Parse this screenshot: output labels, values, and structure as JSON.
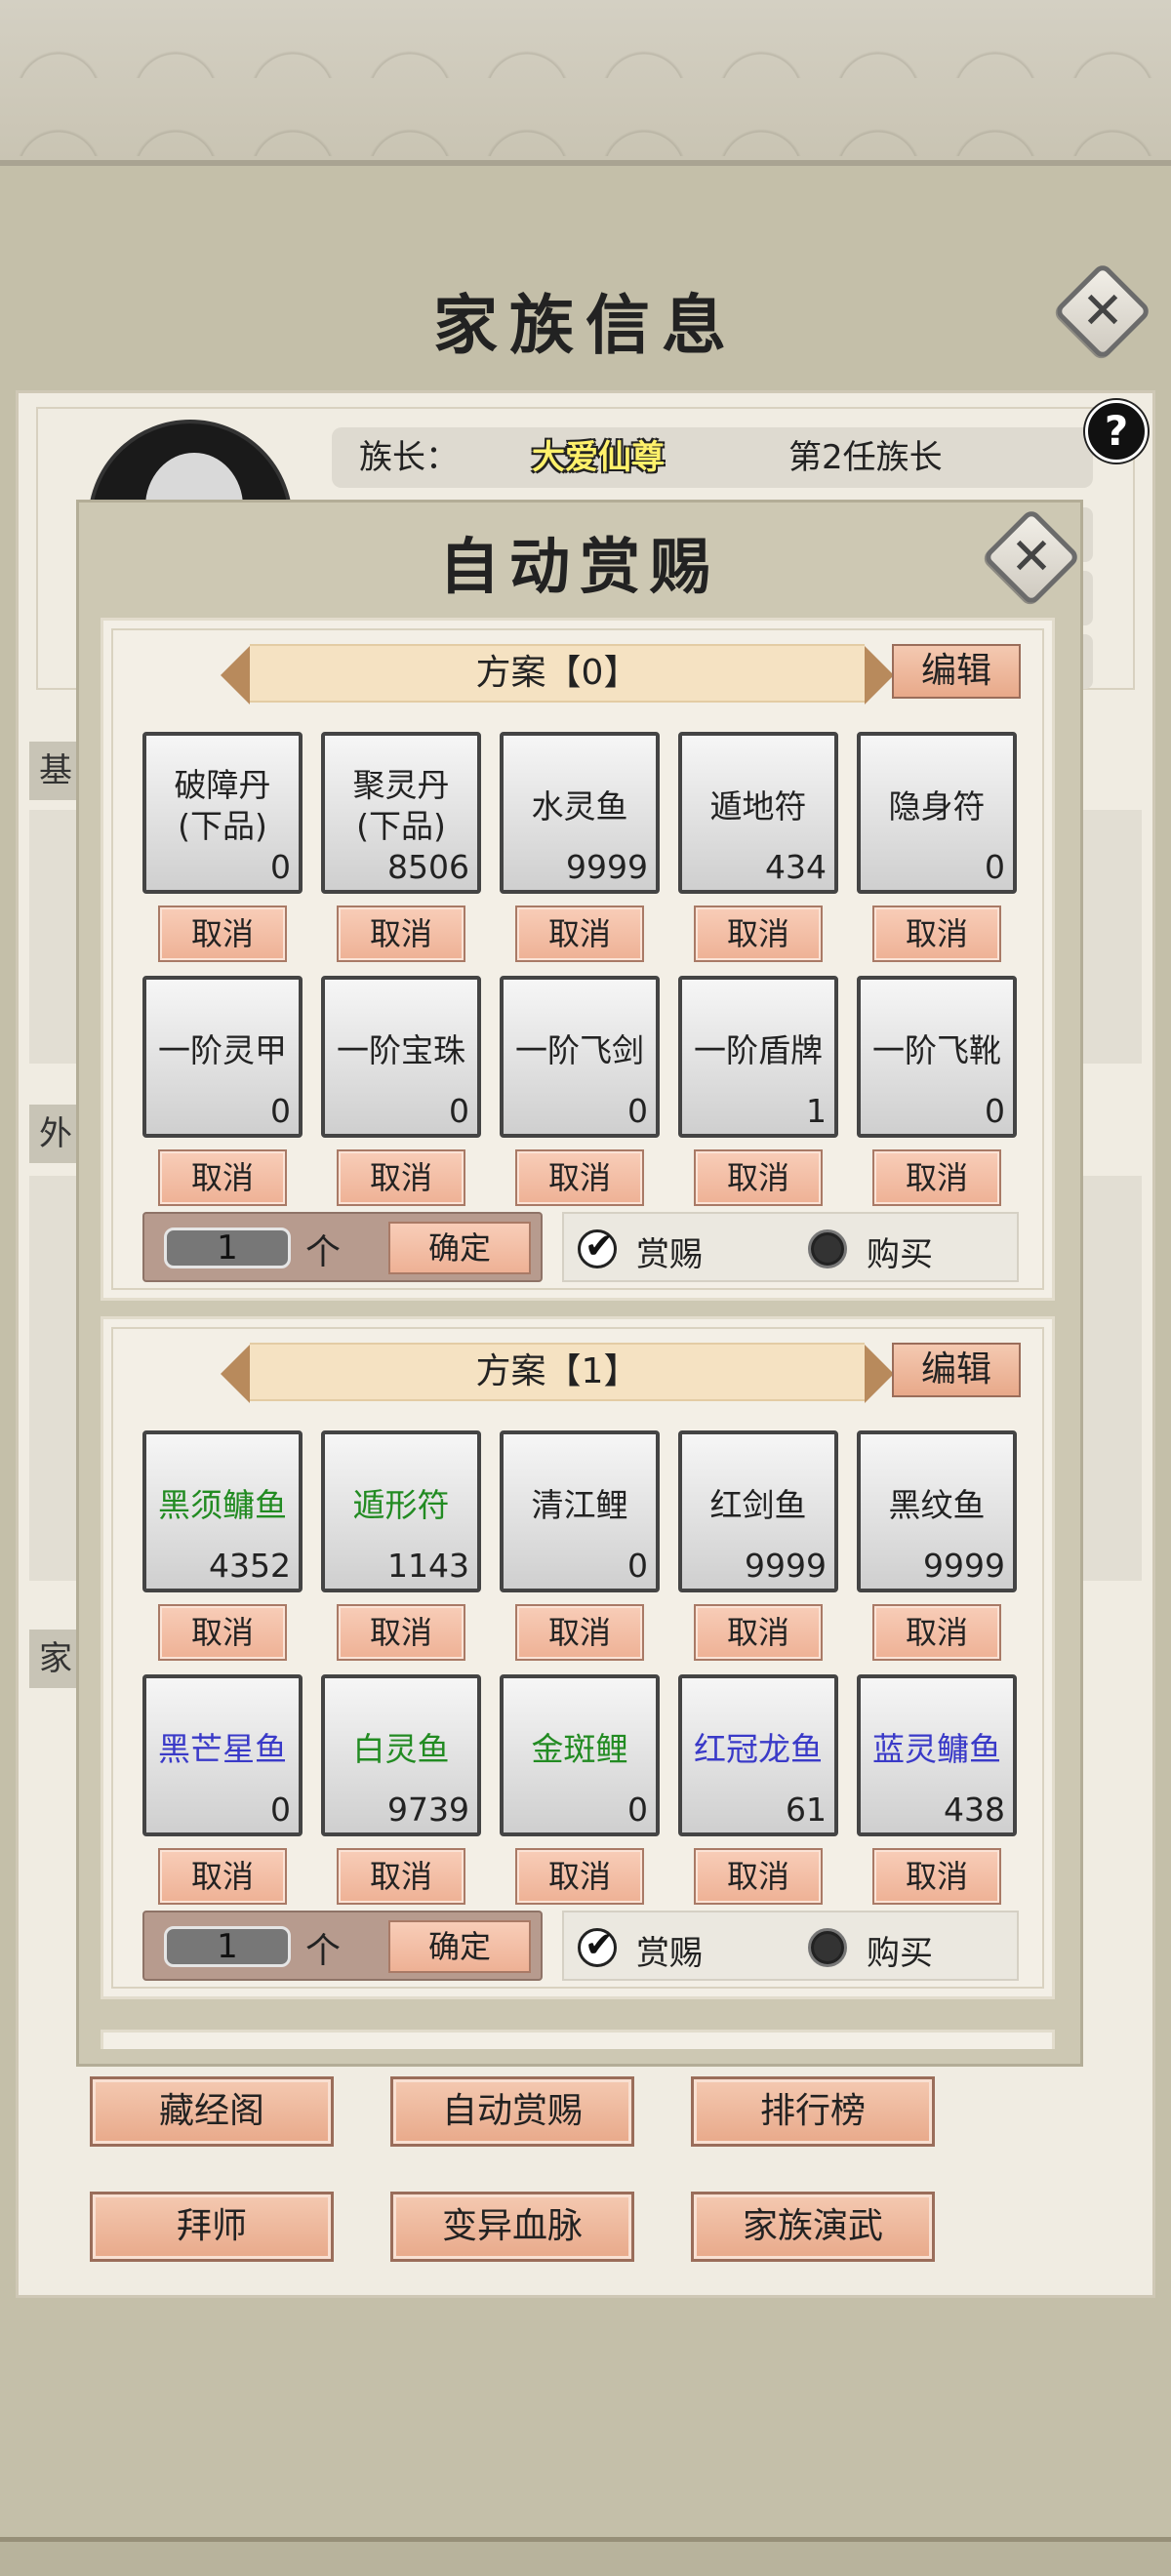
{
  "page": {
    "title": "家族信息"
  },
  "family": {
    "leader_label": "族长：",
    "leader_name": "大爱仙尊",
    "generation": "第2任族长",
    "help": "?",
    "side_tabs": [
      "基",
      "外",
      "家"
    ]
  },
  "bottom_buttons": [
    [
      "藏经阁",
      "自动赏赐",
      "排行榜"
    ],
    [
      "拜师",
      "变异血脉",
      "家族演武"
    ]
  ],
  "modal": {
    "title": "自动赏赐",
    "schemes": [
      {
        "header": "方案【0】",
        "edit": "编辑",
        "items": [
          {
            "name": "破障丹(下品)",
            "count": "0",
            "color": "#222222"
          },
          {
            "name": "聚灵丹(下品)",
            "count": "8506",
            "color": "#222222"
          },
          {
            "name": "水灵鱼",
            "count": "9999",
            "color": "#222222"
          },
          {
            "name": "遁地符",
            "count": "434",
            "color": "#222222"
          },
          {
            "name": "隐身符",
            "count": "0",
            "color": "#222222"
          },
          {
            "name": "一阶灵甲",
            "count": "0",
            "color": "#222222"
          },
          {
            "name": "一阶宝珠",
            "count": "0",
            "color": "#222222"
          },
          {
            "name": "一阶飞剑",
            "count": "0",
            "color": "#222222"
          },
          {
            "name": "一阶盾牌",
            "count": "1",
            "color": "#222222"
          },
          {
            "name": "一阶飞靴",
            "count": "0",
            "color": "#222222"
          }
        ],
        "cancel": "取消",
        "qty": "1",
        "unit": "个",
        "confirm": "确定",
        "reward": "赏赐",
        "buy": "购买",
        "mode": "reward"
      },
      {
        "header": "方案【1】",
        "edit": "编辑",
        "items": [
          {
            "name": "黑须鳙鱼",
            "count": "4352",
            "color": "#228b22"
          },
          {
            "name": "遁形符",
            "count": "1143",
            "color": "#228b22"
          },
          {
            "name": "清江鲤",
            "count": "0",
            "color": "#222222"
          },
          {
            "name": "红剑鱼",
            "count": "9999",
            "color": "#222222"
          },
          {
            "name": "黑纹鱼",
            "count": "9999",
            "color": "#222222"
          },
          {
            "name": "黑芒星鱼",
            "count": "0",
            "color": "#3a3ac8"
          },
          {
            "name": "白灵鱼",
            "count": "9739",
            "color": "#228b22"
          },
          {
            "name": "金斑鲤",
            "count": "0",
            "color": "#228b22"
          },
          {
            "name": "红冠龙鱼",
            "count": "61",
            "color": "#3a3ac8"
          },
          {
            "name": "蓝灵鳙鱼",
            "count": "438",
            "color": "#3a3ac8"
          }
        ],
        "cancel": "取消",
        "qty": "1",
        "unit": "个",
        "confirm": "确定",
        "reward": "赏赐",
        "buy": "购买",
        "mode": "reward"
      }
    ]
  }
}
